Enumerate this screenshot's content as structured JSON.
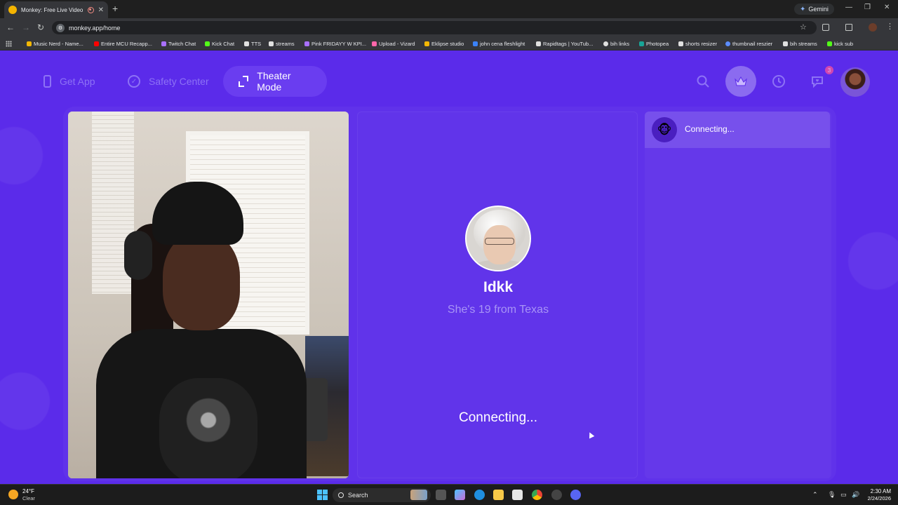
{
  "browser": {
    "tab_title": "Monkey: Free Live Video Ch",
    "new_tab_icon": "+",
    "gemini_label": "Gemini",
    "url": "monkey.app/home",
    "bookmarks": [
      {
        "label": "Music Nerd - Name...",
        "color": "#f2b705"
      },
      {
        "label": "Entire MCU Recapp...",
        "color": "#ff0000"
      },
      {
        "label": "Twitch Chat",
        "color": "#a970ff"
      },
      {
        "label": "Kick Chat",
        "color": "#53fc18"
      },
      {
        "label": "TTS",
        "color": "#e0e0e0"
      },
      {
        "label": "streams",
        "color": "#e0e0e0"
      },
      {
        "label": "Pink FRIDAYY W KPI...",
        "color": "#a970ff"
      },
      {
        "label": "Upload - Vizard",
        "color": "#ff66aa"
      },
      {
        "label": "Eklipse studio",
        "color": "#f2b705"
      },
      {
        "label": "john cena fleshlight",
        "color": "#3b82f6"
      },
      {
        "label": "Rapidtags | YouTub...",
        "color": "#e0e0e0"
      },
      {
        "label": "bih links",
        "color": "#e0e0e0"
      },
      {
        "label": "Photopea",
        "color": "#18a497"
      },
      {
        "label": "shorts resizer",
        "color": "#e0e0e0"
      },
      {
        "label": "thumbnail reszier",
        "color": "#5b8cff"
      },
      {
        "label": "bih streams",
        "color": "#e0e0e0"
      },
      {
        "label": "kick sub",
        "color": "#53fc18"
      }
    ]
  },
  "app": {
    "nav": {
      "get_app": "Get App",
      "safety_center": "Safety Center",
      "theater_mode": "Theater Mode"
    },
    "notification_count": "3",
    "partner": {
      "name": "Idkk",
      "info": "She's 19 from Texas",
      "status": "Connecting..."
    },
    "chat": {
      "status": "Connecting...",
      "monkey_emoji": "🐵"
    },
    "colors": {
      "background": "#5b2bea",
      "accent_button": "#6a3df0",
      "muted_text": "#8d72f5"
    }
  },
  "taskbar": {
    "temperature": "24°F",
    "condition": "Clear",
    "search_label": "Search",
    "time": "2:30 AM",
    "date": "2/24/2026"
  }
}
